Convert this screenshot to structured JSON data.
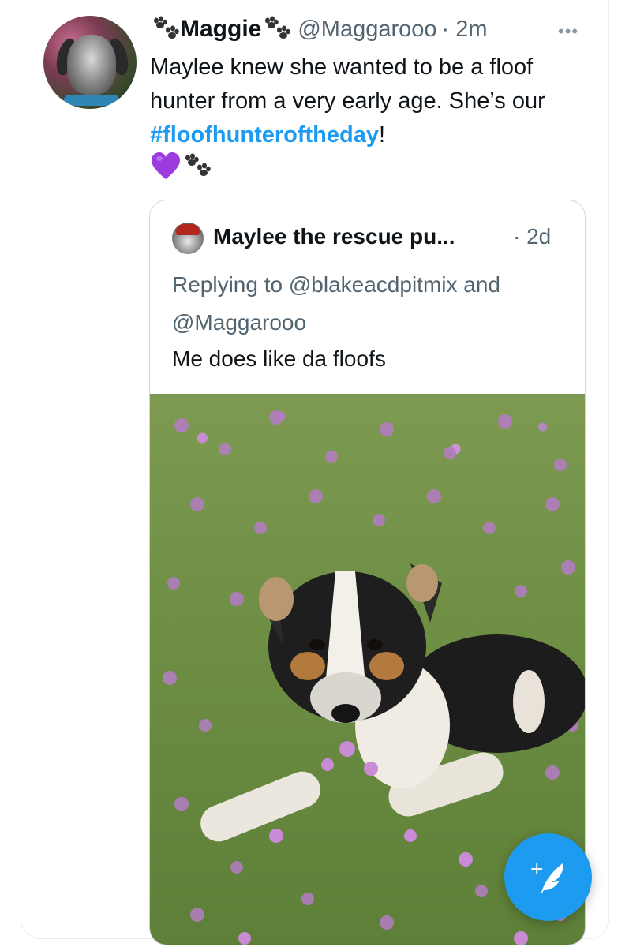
{
  "tweet": {
    "display_name": "Maggie",
    "handle": "@Maggarooo",
    "time": "· 2m",
    "more_icon": "more-horizontal-icon",
    "text_before": "Maylee knew she wanted to be a floof hunter from a very early age. She’s our ",
    "hashtag": "#floofhunteroftheday",
    "text_after": "!"
  },
  "quote": {
    "display_name": "Maylee the rescue pu...",
    "time": "· 2d",
    "replying": "Replying to @blakeacdpitmix and @Maggarooo",
    "text": "Me does like da floofs"
  },
  "fab": {
    "icon": "compose-tweet-icon",
    "plus": "+"
  },
  "colors": {
    "accent": "#1d9bf0",
    "secondary_text": "#536471",
    "border": "#cfd9de"
  }
}
